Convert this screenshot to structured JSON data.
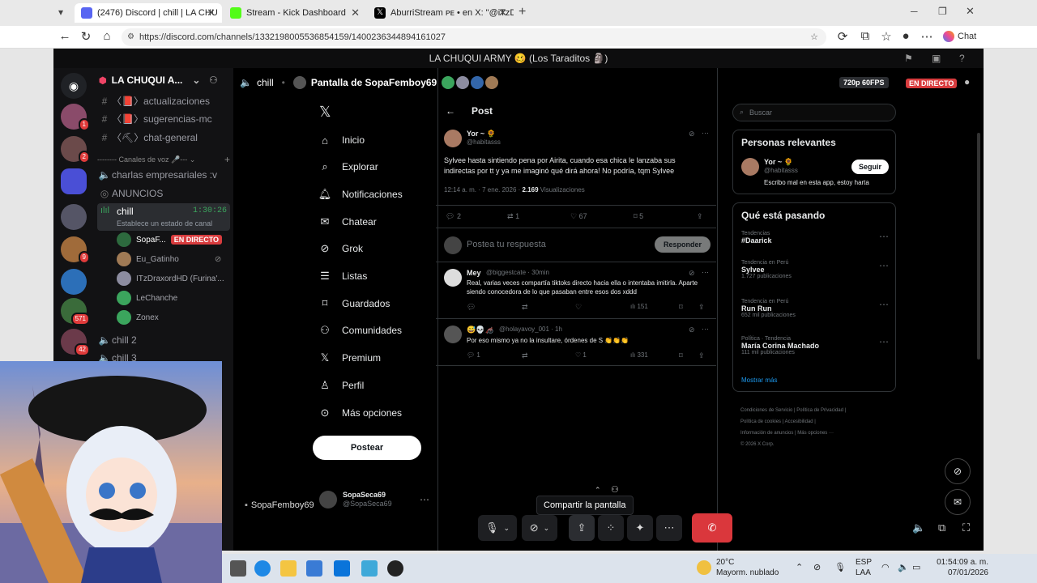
{
  "browser": {
    "tabs": [
      {
        "title": "(2476) Discord | chill | LA CHU",
        "active": true
      },
      {
        "title": "Stream - Kick Dashboard",
        "active": false
      },
      {
        "title": "AburriStream ᴘᴇ • en X: \"@iTzDrax",
        "active": false
      }
    ],
    "url": "https://discord.com/channels/1332198005536854159/1400236344894161027",
    "chat_label": "Chat"
  },
  "discord": {
    "window_title": "LA CHUQUI ARMY 🥴 (Los Taraditos 🗿)",
    "server_name": "LA CHUQUI A...",
    "server_badges": [
      "1",
      "2",
      "9",
      "571",
      "42"
    ],
    "channels": [
      {
        "icon": "#",
        "label": "〈📕〉actualizaciones"
      },
      {
        "icon": "#",
        "label": "〈📕〉sugerencias-mc"
      },
      {
        "icon": "#",
        "label": "〈⛏〉chat-general"
      }
    ],
    "voice_category": "-------- Canales de voz 🎤--- ⌄",
    "voice_channels": [
      "charlas empresariales :v",
      "ANUNCIOS"
    ],
    "active_channel": {
      "name": "chill",
      "time": "1:30:26",
      "status": "Establece un estado de canal"
    },
    "members": [
      "SopaF...",
      "Eu_Gatinho",
      "ITzDraxordHD (Furina'...",
      "LeChanche",
      "Zonex"
    ],
    "live_label": "EN DIRECTO",
    "more_channels": [
      "chill 2",
      "chill 3"
    ],
    "stream_channel": "chill",
    "stream_title": "Pantalla de SopaFemboy69",
    "quality": "720p 60FPS",
    "stream_user": "SopaFemboy69",
    "share_tooltip": "Compartir la pantalla"
  },
  "x": {
    "nav": [
      "Inicio",
      "Explorar",
      "Notificaciones",
      "Chatear",
      "Grok",
      "Listas",
      "Guardados",
      "Comunidades",
      "Premium",
      "Perfil",
      "Más opciones"
    ],
    "post_button": "Postear",
    "account": {
      "name": "SopaSeca69",
      "handle": "@SopaSeca69"
    },
    "header": "Post",
    "main_post": {
      "author": "Yor ~ 🌻",
      "handle": "@habitasss",
      "text": "Sylvee hasta sintiendo pena por Airita, cuando esa chica le lanzaba sus indirectas por tt y ya me imaginó qué dirá ahora! No podría, tqm Sylvee",
      "time": "12:14 a. m. · 7 ene. 2026 ·",
      "views": "2.169",
      "views_label": "Visualizaciones",
      "replies": "2",
      "reposts": "1",
      "likes": "67",
      "bookmarks": "5"
    },
    "reply_placeholder": "Postea tu respuesta",
    "reply_button": "Responder",
    "replies": [
      {
        "author": "Mey",
        "handle": "@biggestcate · 30min",
        "text": "Real, varias veces compartía tiktoks directo hacia ella o intentaba imitirla. Aparte siendo conocedora de lo que pasaban entre esos dos xddd",
        "views": "151"
      },
      {
        "author": "😅💀🦽",
        "handle": "@holayavoy_001 · 1h",
        "text": "Por eso mismo ya no la insultare, órdenes de S 👏👏👏",
        "replies": "1",
        "likes": "1",
        "views": "331"
      }
    ],
    "search_placeholder": "Buscar",
    "relevant": {
      "title": "Personas relevantes",
      "name": "Yor ~ 🌻",
      "handle": "@habitasss",
      "bio": "Escribo mal en esta app, estoy harta",
      "follow": "Seguir"
    },
    "trends": {
      "title": "Qué está pasando",
      "items": [
        {
          "context": "Tendencias",
          "name": "#Daarick",
          "count": ""
        },
        {
          "context": "Tendencia en Perú",
          "name": "Sylvee",
          "count": "1.727 publicaciones"
        },
        {
          "context": "Tendencia en Perú",
          "name": "Run Run",
          "count": "652 mil publicaciones"
        },
        {
          "context": "Política · Tendencia",
          "name": "María Corina Machado",
          "count": "111 mil publicaciones"
        }
      ],
      "more": "Mostrar más"
    },
    "footer": [
      "Condiciones de Servicio",
      "Política de Privacidad",
      "Política de cookies",
      "Accesibilidad",
      "Información de anuncios",
      "Más opciones ···",
      "© 2026 X Corp."
    ]
  },
  "taskbar": {
    "weather_temp": "20°C",
    "weather_desc": "Mayorm. nublado",
    "lang1": "ESP",
    "lang2": "LAA",
    "time": "01:54:09 a. m.",
    "date": "07/01/2026"
  },
  "colors": {
    "discord_bg": "#0d0d0e",
    "live_red": "#d83c3e",
    "accent_green": "#3ba55d",
    "x_blue": "#1d9bf0"
  }
}
